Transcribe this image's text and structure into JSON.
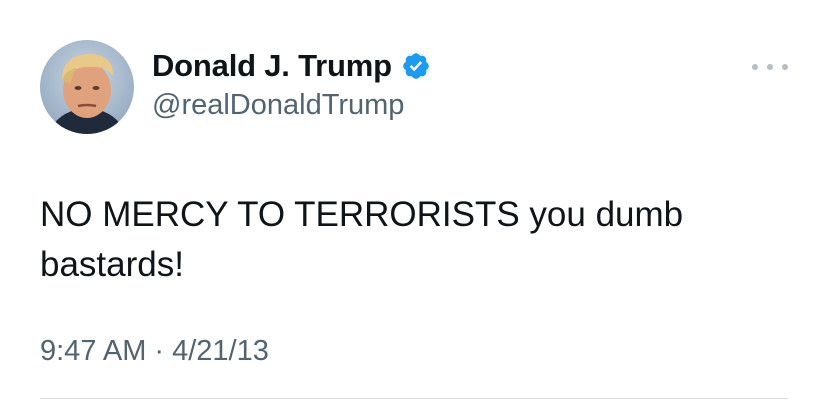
{
  "author": {
    "display_name": "Donald J. Trump",
    "handle": "@realDonaldTrump",
    "verified": true,
    "avatar_icon": "profile-photo"
  },
  "tweet": {
    "text": "NO MERCY TO TERRORISTS you dumb bastards!",
    "time": "9:47 AM",
    "separator": "·",
    "date": "4/21/13"
  },
  "icons": {
    "verified": "verified-badge-icon",
    "more": "more-options-icon"
  },
  "colors": {
    "text_primary": "#0f1419",
    "text_secondary": "#536471",
    "verified_blue": "#1d9bf0",
    "divider": "#d9dee2"
  }
}
